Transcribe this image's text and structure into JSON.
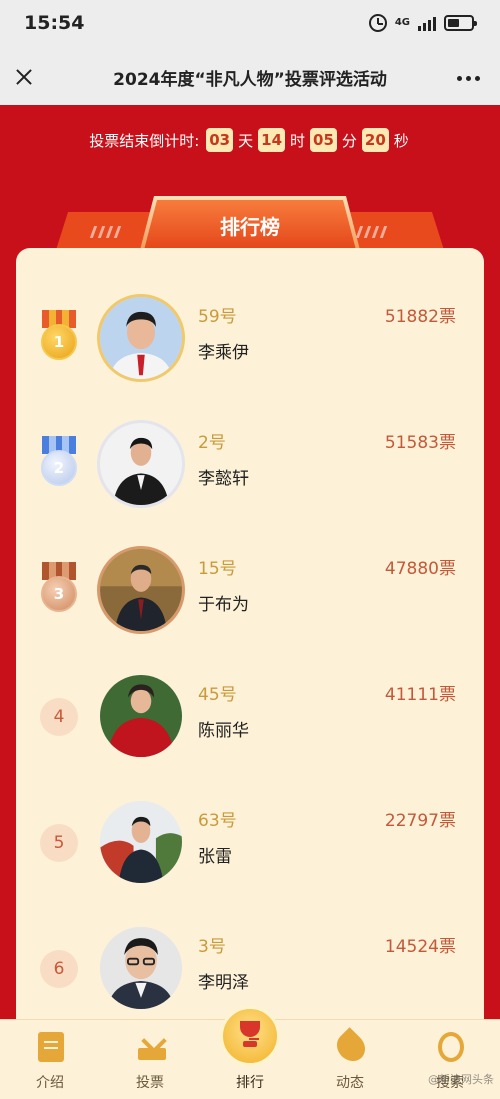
{
  "status_bar": {
    "time": "15:54",
    "network": "4G"
  },
  "nav": {
    "title": "2024年度“非凡人物”投票评选活动"
  },
  "countdown": {
    "label": "投票结束倒计时:",
    "days": "03",
    "days_unit": "天",
    "hours": "14",
    "hours_unit": "时",
    "minutes": "05",
    "minutes_unit": "分",
    "seconds": "20",
    "seconds_unit": "秒"
  },
  "board": {
    "title": "排行榜",
    "rows": [
      {
        "rank": "1",
        "number": "59号",
        "name": "李乘伊",
        "votes": "51882票"
      },
      {
        "rank": "2",
        "number": "2号",
        "name": "李懿轩",
        "votes": "51583票"
      },
      {
        "rank": "3",
        "number": "15号",
        "name": "于布为",
        "votes": "47880票"
      },
      {
        "rank": "4",
        "number": "45号",
        "name": "陈丽华",
        "votes": "41111票"
      },
      {
        "rank": "5",
        "number": "63号",
        "name": "张雷",
        "votes": "22797票"
      },
      {
        "rank": "6",
        "number": "3号",
        "name": "李明泽",
        "votes": "14524票"
      }
    ]
  },
  "tabs": [
    {
      "label": "介绍",
      "icon": "document-icon"
    },
    {
      "label": "投票",
      "icon": "vote-icon"
    },
    {
      "label": "排行",
      "icon": "trophy-icon",
      "active": true
    },
    {
      "label": "动态",
      "icon": "leaf-icon"
    },
    {
      "label": "搜索",
      "icon": "search-icon"
    }
  ],
  "watermark": "@新浪网头条"
}
